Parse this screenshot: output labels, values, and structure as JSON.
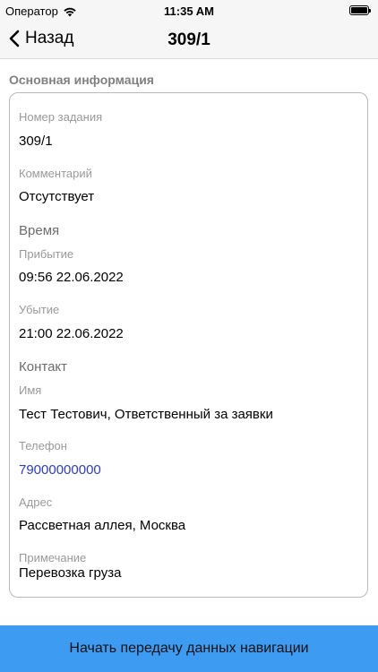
{
  "status_bar": {
    "carrier": "Оператор",
    "time": "11:35 AM"
  },
  "nav": {
    "back_label": "Назад",
    "title": "309/1"
  },
  "section_title": "Основная информация",
  "task_number": {
    "label": "Номер задания",
    "value": "309/1"
  },
  "comment": {
    "label": "Комментарий",
    "value": "Отсутствует"
  },
  "time_group": {
    "title": "Время",
    "arrival": {
      "label": "Прибытие",
      "value": "09:56 22.06.2022"
    },
    "departure": {
      "label": "Убытие",
      "value": "21:00 22.06.2022"
    }
  },
  "contact_group": {
    "title": "Контакт",
    "name": {
      "label": "Имя",
      "value": "Тест Тестович, Ответственный за заявки"
    },
    "phone": {
      "label": "Телефон",
      "value": "79000000000"
    },
    "address": {
      "label": "Адрес",
      "value": "Рассветная аллея, Москва"
    },
    "note": {
      "label": "Примечание",
      "value": "Перевозка груза"
    }
  },
  "action_button": {
    "label": "Начать передачу данных навигации"
  },
  "colors": {
    "accent": "#3d9bf2",
    "link": "#2b3ad1"
  }
}
